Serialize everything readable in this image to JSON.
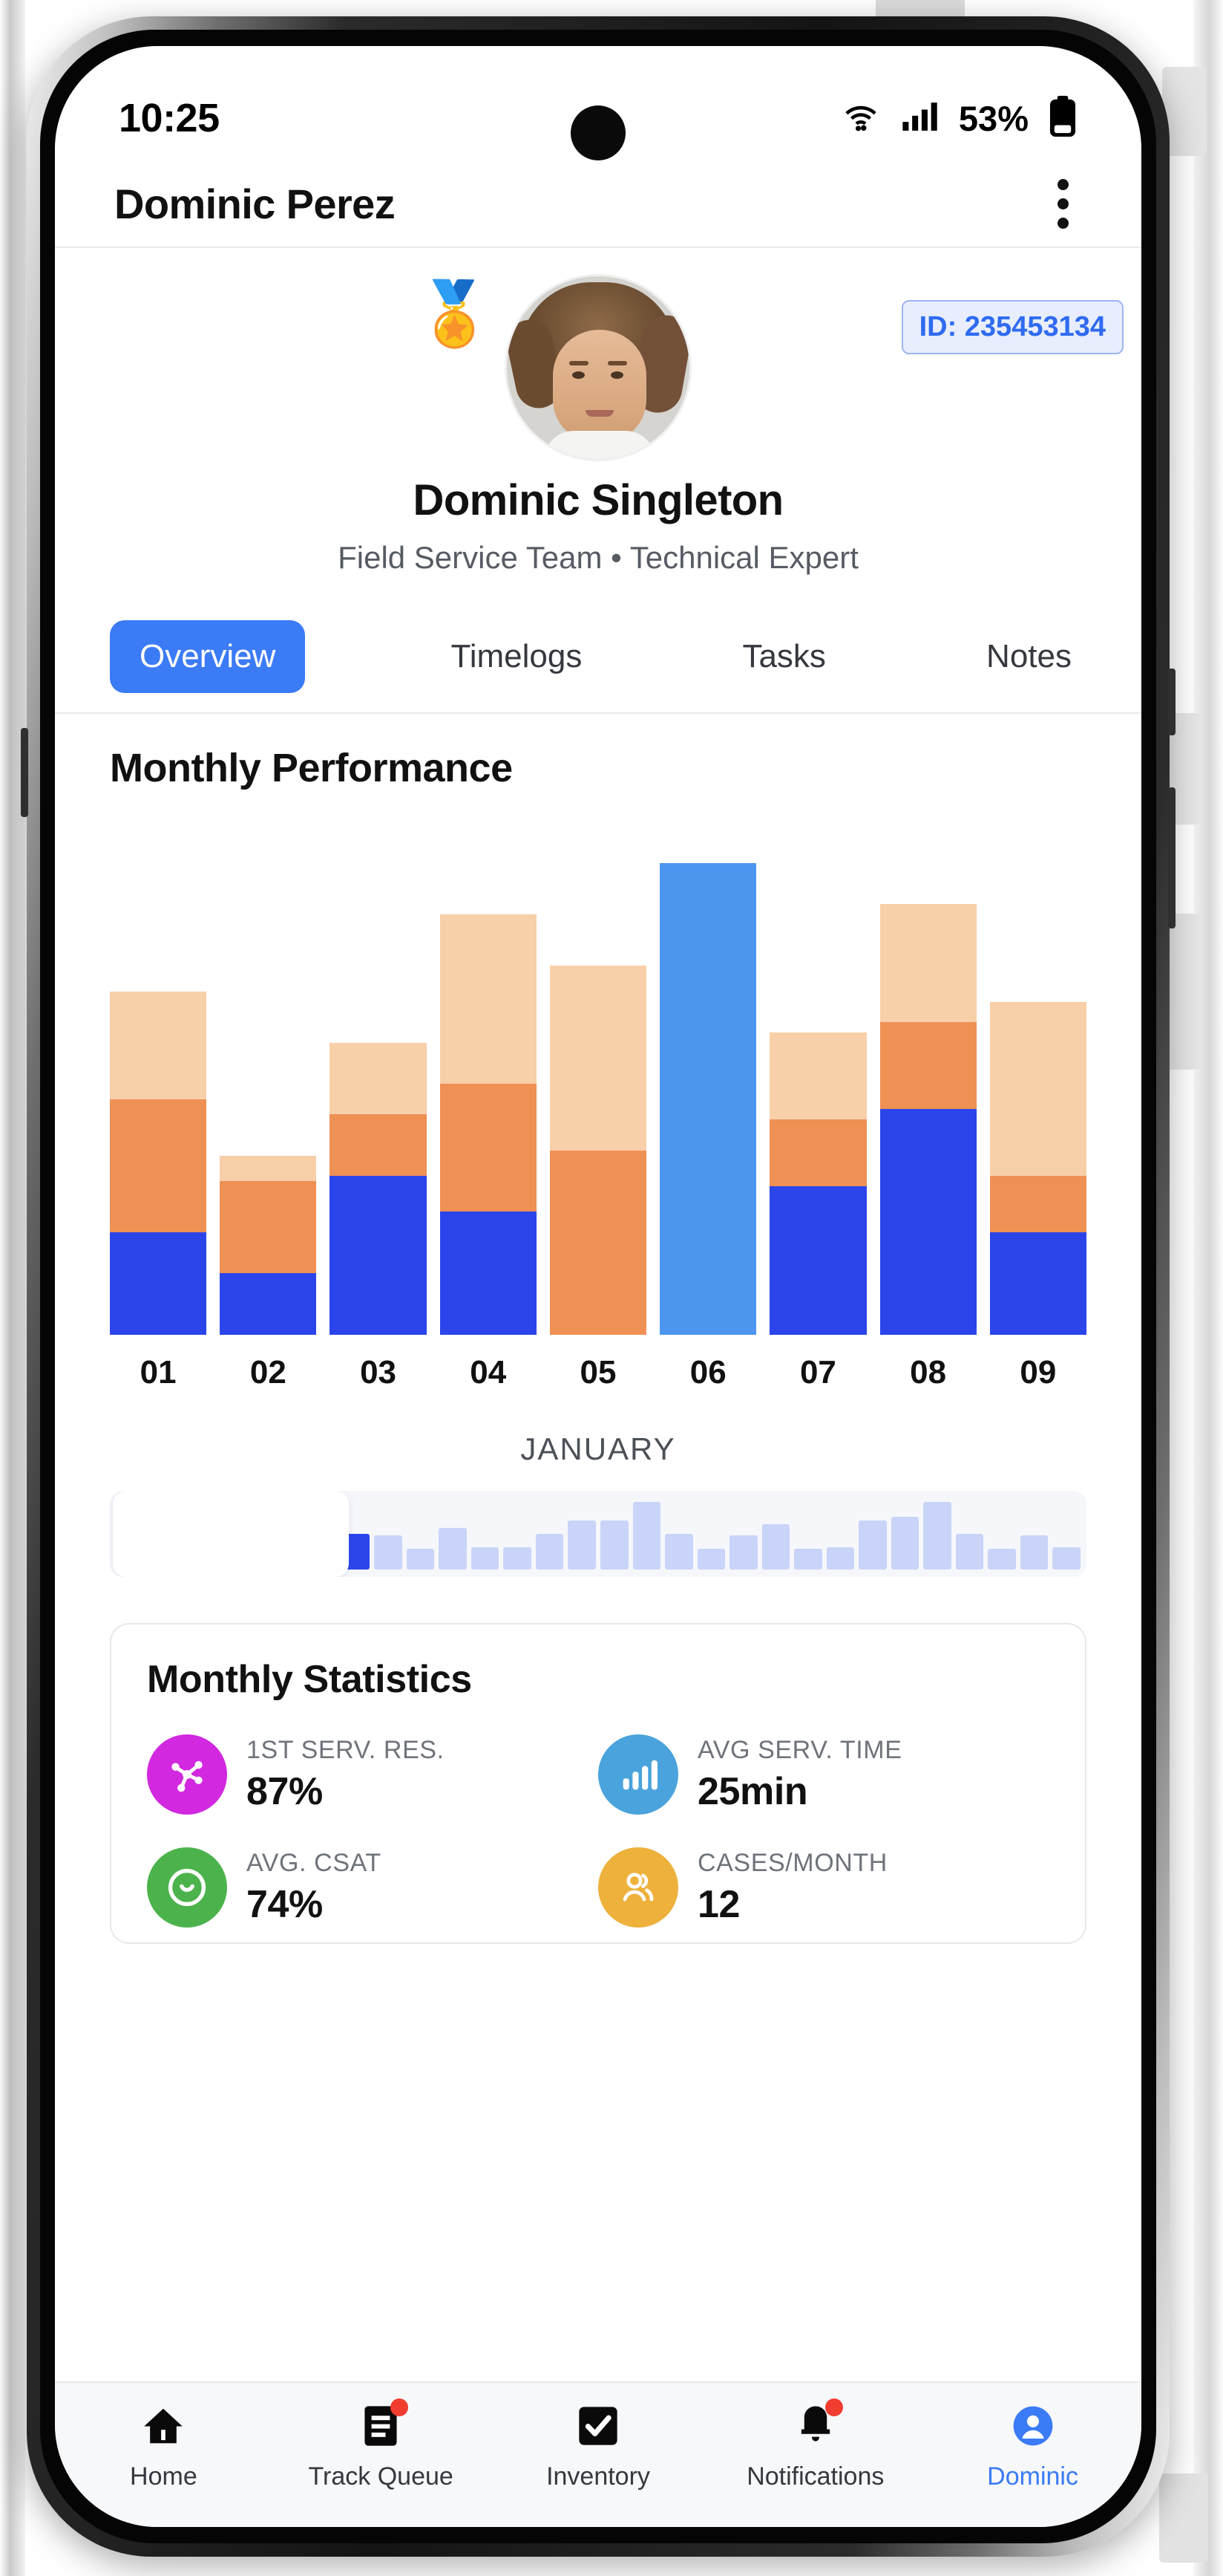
{
  "status_bar": {
    "time": "10:25",
    "battery_percent": "53%",
    "icons": [
      "wifi-icon",
      "cellular-signal-icon",
      "battery-icon"
    ]
  },
  "app_bar": {
    "title": "Dominic Perez",
    "menu_icon": "more-vertical-icon"
  },
  "profile": {
    "badge_icon": "medal-award-icon",
    "avatar_alt": "avatar",
    "id_badge": "ID: 235453134",
    "name": "Dominic Singleton",
    "role": "Field Service Team • Technical Expert"
  },
  "tabs": {
    "items": [
      {
        "label": "Overview",
        "active": true
      },
      {
        "label": "Timelogs",
        "active": false
      },
      {
        "label": "Tasks",
        "active": false
      },
      {
        "label": "Notes",
        "active": false
      }
    ]
  },
  "chart_data": {
    "type": "bar",
    "title": "Monthly Performance",
    "subtitle": "JANUARY",
    "xlabel": "",
    "ylabel": "",
    "grid": false,
    "legend": "none",
    "stacked": true,
    "ylim": [
      0,
      100
    ],
    "categories": [
      "01",
      "02",
      "03",
      "04",
      "05",
      "06",
      "07",
      "08",
      "09"
    ],
    "series": [
      {
        "name": "completed",
        "color": "#2b45ea",
        "values": [
          20,
          12,
          31,
          24,
          0,
          0,
          29,
          44,
          20
        ]
      },
      {
        "name": "in-progress",
        "color": "#ef9055",
        "values": [
          26,
          18,
          12,
          25,
          36,
          0,
          13,
          17,
          11
        ]
      },
      {
        "name": "pending",
        "color": "#f7cfa8",
        "values": [
          21,
          5,
          14,
          33,
          36,
          0,
          17,
          23,
          34
        ]
      },
      {
        "name": "selected-total",
        "color": "#4d96f0",
        "values": [
          0,
          0,
          0,
          0,
          0,
          92,
          0,
          0,
          0
        ]
      }
    ],
    "selected_category": "06",
    "minimap": {
      "selected_count": 9,
      "selected_values": [
        46,
        22,
        24,
        38,
        48,
        48,
        72,
        38
      ],
      "rest_values": [
        36,
        22,
        44,
        24,
        24,
        38,
        52,
        52,
        72,
        38,
        22,
        36,
        48,
        22,
        24,
        52,
        56,
        72,
        38,
        22,
        36,
        24
      ]
    }
  },
  "stats": {
    "title": "Monthly Statistics",
    "items": [
      {
        "label": "1ST SERV. RES.",
        "value": "87%",
        "icon": "network-hub-icon",
        "color": "#d128e0"
      },
      {
        "label": "AVG SERV. TIME",
        "value": "25min",
        "icon": "bar-chart-icon",
        "color": "#4aa3dc"
      },
      {
        "label": "AVG. CSAT",
        "value": "74%",
        "icon": "smiley-target-icon",
        "color": "#4cb34c"
      },
      {
        "label": "CASES/MONTH",
        "value": "12",
        "icon": "users-icon",
        "color": "#edb13c"
      }
    ]
  },
  "bottom_nav": {
    "items": [
      {
        "label": "Home",
        "icon": "home-icon",
        "badge": false,
        "active": false
      },
      {
        "label": "Track Queue",
        "icon": "list-document-icon",
        "badge": true,
        "active": false
      },
      {
        "label": "Inventory",
        "icon": "checkbox-icon",
        "badge": false,
        "active": false
      },
      {
        "label": "Notifications",
        "icon": "bell-icon",
        "badge": true,
        "active": false
      },
      {
        "label": "Dominic",
        "icon": "user-avatar-icon",
        "badge": false,
        "active": true
      }
    ]
  },
  "theme": {
    "accent": "#3b7bf6",
    "bar_blue": "#2b45ea",
    "bar_orange": "#ef9055",
    "bar_light": "#f7cfa8",
    "bar_highlight": "#4d96f0",
    "badge_red": "#f03d2f"
  }
}
